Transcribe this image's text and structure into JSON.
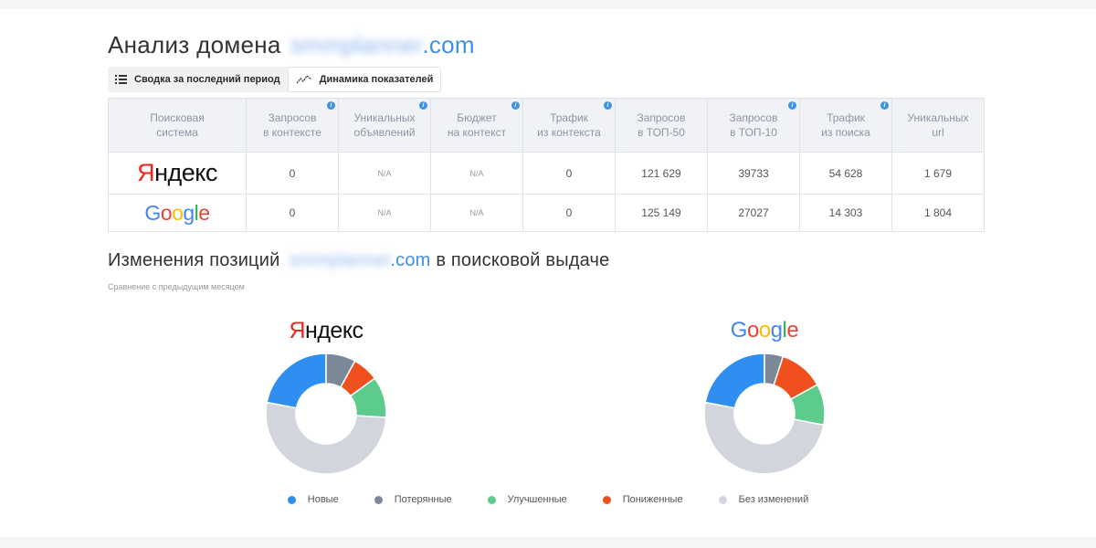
{
  "page": {
    "title": "Анализ домена",
    "domain_blurred": "smmplanner",
    "domain_tld": ".com"
  },
  "tabs": [
    {
      "label": "Сводка за последний период",
      "icon": "list-icon",
      "active": false
    },
    {
      "label": "Динамика показателей",
      "icon": "trend-line-icon",
      "active": true
    }
  ],
  "table": {
    "headers": [
      "Поисковая система",
      "Запросов в контексте",
      "Уникальных объявлений",
      "Бюджет на контекст",
      "Трафик из контекста",
      "Запросов в ТОП-50",
      "Запросов в ТОП-10",
      "Трафик из поиска",
      "Уникальных url"
    ],
    "header_lines": [
      [
        "Поисковая",
        "система"
      ],
      [
        "Запросов",
        "в контексте"
      ],
      [
        "Уникальных",
        "объявлений"
      ],
      [
        "Бюджет",
        "на контекст"
      ],
      [
        "Трафик",
        "из контекста"
      ],
      [
        "Запросов",
        "в ТОП-50"
      ],
      [
        "Запросов",
        "в ТОП-10"
      ],
      [
        "Трафик",
        "из поиска"
      ],
      [
        "Уникальных",
        "url"
      ]
    ],
    "info_icon": "i",
    "rows": [
      {
        "engine": "Яндекс",
        "values": [
          "0",
          "N/A",
          "N/A",
          "0",
          "121 629",
          "39733",
          "54 628",
          "1 679"
        ]
      },
      {
        "engine": "Google",
        "values": [
          "0",
          "N/A",
          "N/A",
          "0",
          "125 149",
          "27027",
          "14 303",
          "1 804"
        ]
      }
    ]
  },
  "positions": {
    "title_prefix": "Изменения позиций",
    "domain_blurred": "smmplanner",
    "domain_tld": ".com",
    "title_suffix": "в поисковой выдаче",
    "subtitle": "Сравнение с предыдущим месяцем"
  },
  "logos": {
    "yandex_first": "Я",
    "yandex_rest": "ндекс",
    "google_letters": [
      "G",
      "o",
      "o",
      "g",
      "l",
      "e"
    ],
    "google_colors": [
      "#4285F4",
      "#EA4335",
      "#FBBC05",
      "#4285F4",
      "#34A853",
      "#EA4335"
    ]
  },
  "chart_data": [
    {
      "type": "pie",
      "engine": "Яндекс",
      "categories": [
        "Новые",
        "Потерянные",
        "Понижённые",
        "Улучшенные",
        "Без изменений"
      ],
      "values": [
        22,
        8,
        7,
        11,
        52
      ]
    },
    {
      "type": "pie",
      "engine": "Google",
      "categories": [
        "Новые",
        "Потерянные",
        "Понижённые",
        "Улучшенные",
        "Без изменений"
      ],
      "values": [
        22,
        5,
        12,
        11,
        50
      ]
    }
  ],
  "legend": [
    {
      "label": "Новые",
      "color": "#2f8ff1"
    },
    {
      "label": "Потерянные",
      "color": "#7b8898"
    },
    {
      "label": "Улучшенные",
      "color": "#5dcb8c"
    },
    {
      "label": "Пониженные",
      "color": "#f0501e"
    },
    {
      "label": "Без изменений",
      "color": "#d2d6dc"
    }
  ],
  "colors": {
    "new": "#2f8ff1",
    "lost": "#7b8898",
    "improved": "#5dcb8c",
    "lowered": "#f0501e",
    "unchanged": "#d2d6dc",
    "accent": "#3d8fe8"
  }
}
